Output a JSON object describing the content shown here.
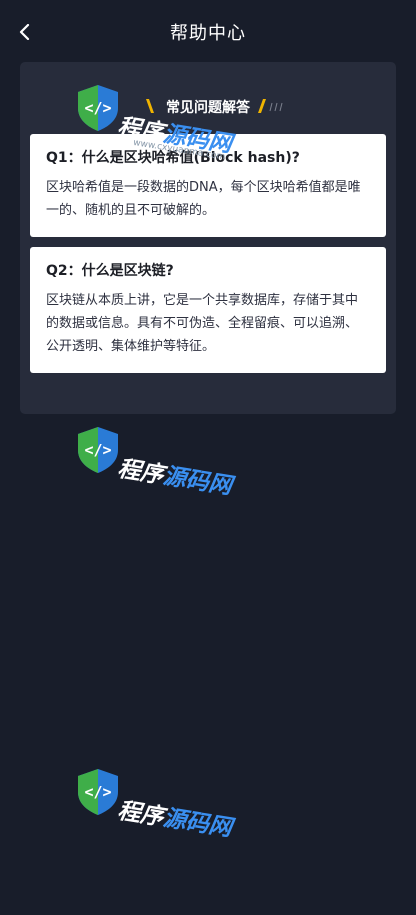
{
  "header": {
    "title": "帮助中心",
    "back_icon": "chevron-left-icon"
  },
  "section": {
    "title": "常见问题解答",
    "accent_color": "#f0b400"
  },
  "faqs": [
    {
      "question": "Q1：什么是区块哈希值(Block hash)?",
      "answer": "区块哈希值是一段数据的DNA，每个区块哈希值都是唯一的、随机的且不可破解的。"
    },
    {
      "question": "Q2：什么是区块链?",
      "answer": "区块链从本质上讲，它是一个共享数据库，存储于其中的数据或信息。具有不可伪造、全程留痕、可以追溯、公开透明、集体维护等特征。"
    }
  ],
  "watermark": {
    "text_part1": "程序",
    "text_part2": "源码网",
    "url": "www.cxyuanma.com"
  },
  "colors": {
    "background": "#181d2a",
    "panel": "#272c3b",
    "card": "#ffffff",
    "watermark_blue": "#3a8ff0",
    "watermark_green": "#3fae49"
  }
}
